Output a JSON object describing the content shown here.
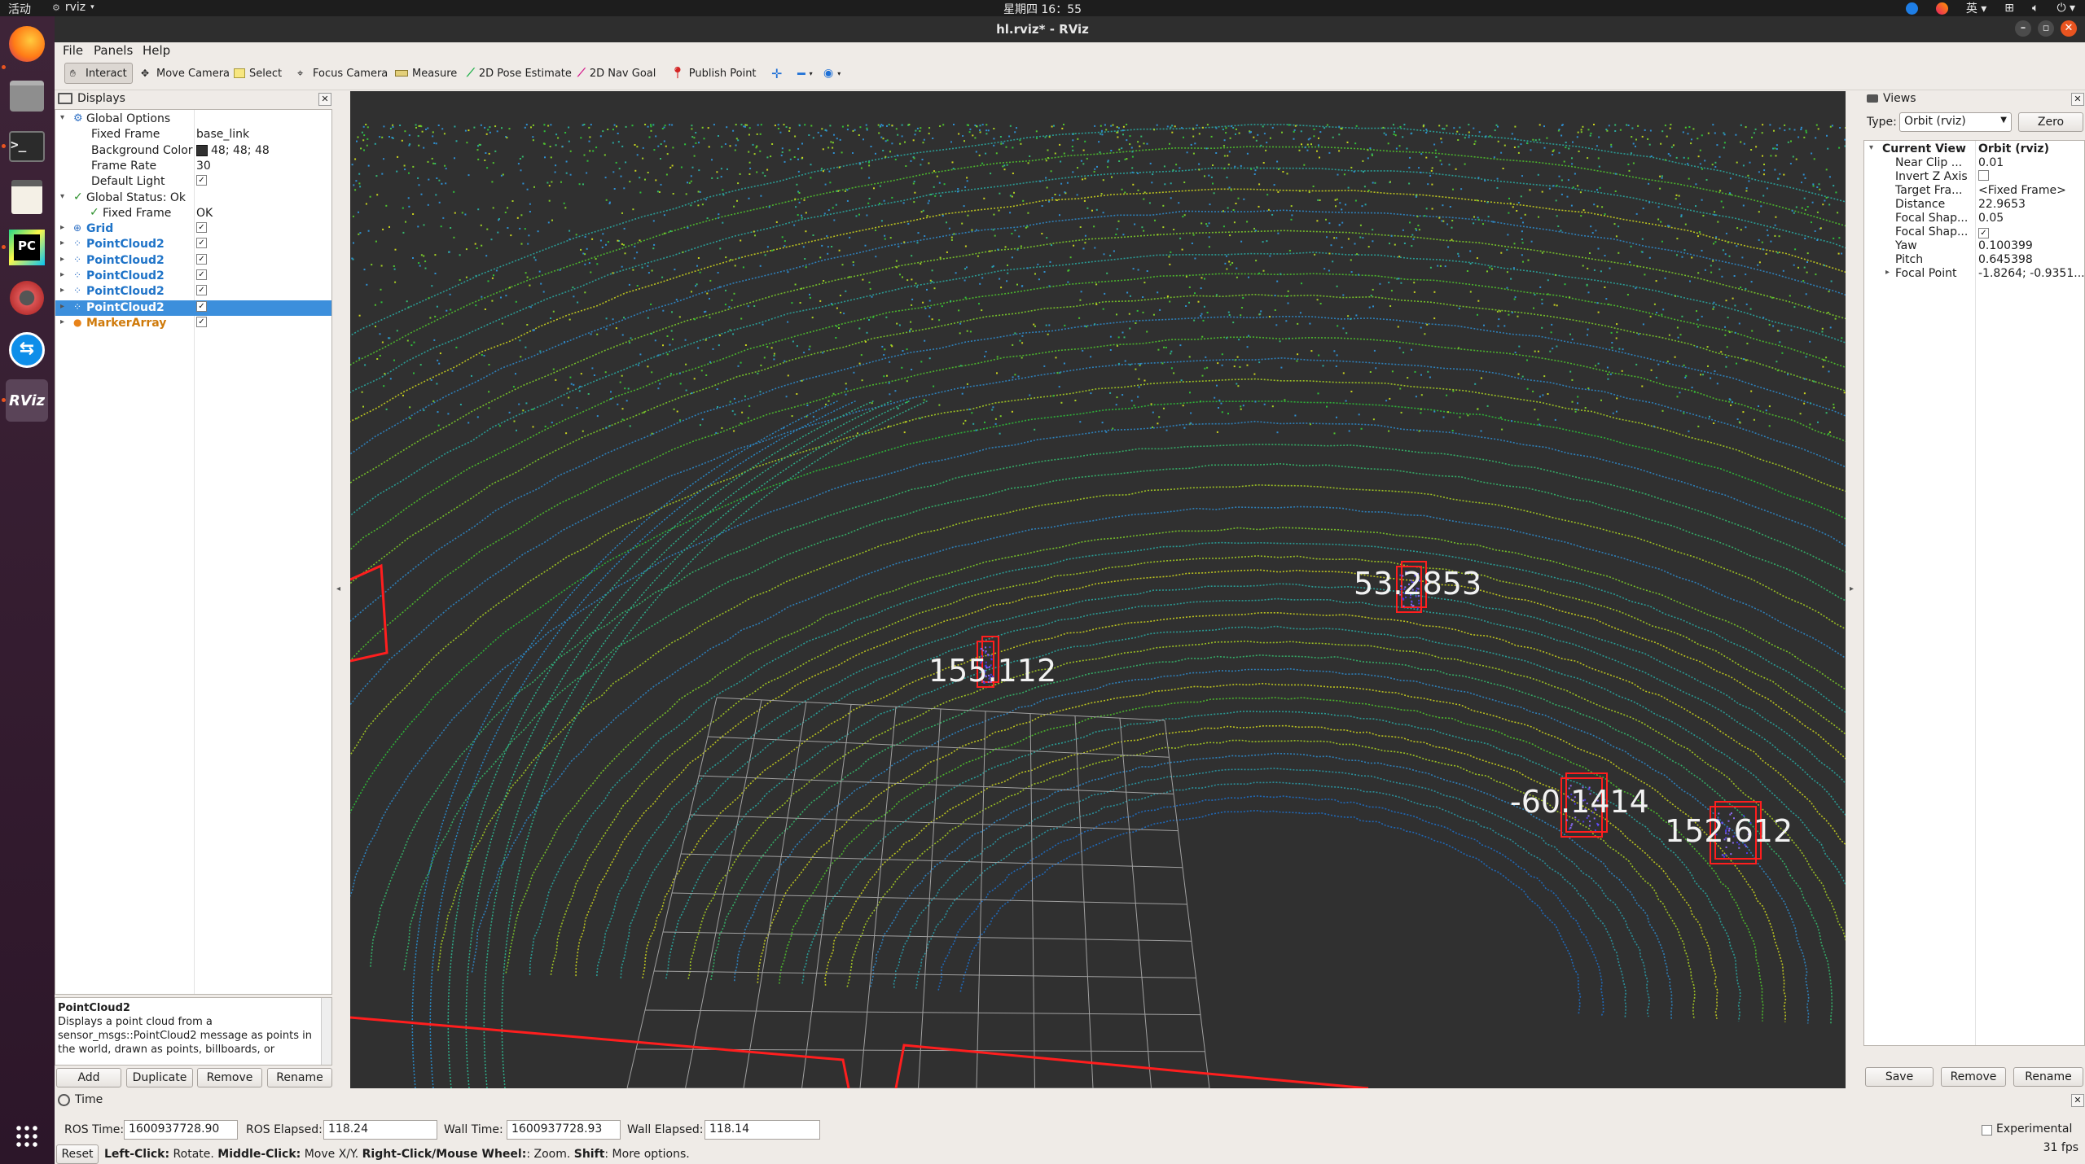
{
  "topbar": {
    "activities": "活动",
    "app_name": "rviz",
    "clock": "星期四 16：55",
    "input_method": "英"
  },
  "window": {
    "title": "hl.rviz* - RViz"
  },
  "dock": {
    "icons": [
      "firefox-icon",
      "files-icon",
      "terminal-icon",
      "text-editor-icon",
      "pycharm-icon",
      "settings-icon",
      "teamviewer-icon",
      "rviz-icon",
      "apps-grid-icon"
    ],
    "pycharm_text": "PC",
    "rviz_text": "RViz"
  },
  "menu": {
    "file": "File",
    "panels": "Panels",
    "help": "Help"
  },
  "toolbar": {
    "interact": "Interact",
    "move_camera": "Move Camera",
    "select": "Select",
    "focus_camera": "Focus Camera",
    "measure": "Measure",
    "pose_estimate": "2D Pose Estimate",
    "nav_goal": "2D Nav Goal",
    "publish_point": "Publish Point"
  },
  "displays": {
    "title": "Displays",
    "global_options": "Global Options",
    "fixed_frame_label": "Fixed Frame",
    "fixed_frame_value": "base_link",
    "bg_color_label": "Background Color",
    "bg_color_value": "48; 48; 48",
    "bg_color_swatch": "#303030",
    "frame_rate_label": "Frame Rate",
    "frame_rate_value": "30",
    "default_light_label": "Default Light",
    "global_status": "Global Status: Ok",
    "status_fixed_frame_label": "Fixed Frame",
    "status_fixed_frame_value": "OK",
    "items": [
      {
        "label": "Grid",
        "checked": true
      },
      {
        "label": "PointCloud2",
        "checked": true
      },
      {
        "label": "PointCloud2",
        "checked": true
      },
      {
        "label": "PointCloud2",
        "checked": true
      },
      {
        "label": "PointCloud2",
        "checked": true
      },
      {
        "label": "PointCloud2",
        "checked": true,
        "selected": true
      },
      {
        "label": "MarkerArray",
        "checked": true
      }
    ],
    "desc_title": "PointCloud2",
    "desc_text": "Displays a point cloud from a sensor_msgs::PointCloud2 message as points in the world, drawn as points, billboards, or",
    "buttons": {
      "add": "Add",
      "duplicate": "Duplicate",
      "remove": "Remove",
      "rename": "Rename"
    }
  },
  "viewport": {
    "markers": [
      "53.2853",
      "155.112",
      "-60.1414",
      "152.612"
    ],
    "colors": {
      "background": "#303030",
      "box": "#ff1e1e",
      "grid": "#a0a0a0"
    }
  },
  "views": {
    "title": "Views",
    "type_label": "Type:",
    "type_value": "Orbit (rviz)",
    "zero": "Zero",
    "current_view_label": "Current View",
    "current_view_value": "Orbit (rviz)",
    "props": [
      {
        "label": "Near Clip ...",
        "value": "0.01"
      },
      {
        "label": "Invert Z Axis",
        "value": "",
        "checkbox": true,
        "checked": false
      },
      {
        "label": "Target Fra...",
        "value": "<Fixed Frame>"
      },
      {
        "label": "Distance",
        "value": "22.9653"
      },
      {
        "label": "Focal Shap...",
        "value": "0.05"
      },
      {
        "label": "Focal Shap...",
        "value": "",
        "checkbox": true,
        "checked": true
      },
      {
        "label": "Yaw",
        "value": "0.100399"
      },
      {
        "label": "Pitch",
        "value": "0.645398"
      },
      {
        "label": "Focal Point",
        "value": "-1.8264; -0.9351..."
      }
    ],
    "buttons": {
      "save": "Save",
      "remove": "Remove",
      "rename": "Rename"
    }
  },
  "time": {
    "title": "Time",
    "ros_time_label": "ROS Time:",
    "ros_time_value": "1600937728.90",
    "ros_elapsed_label": "ROS Elapsed:",
    "ros_elapsed_value": "118.24",
    "wall_time_label": "Wall Time:",
    "wall_time_value": "1600937728.93",
    "wall_elapsed_label": "Wall Elapsed:",
    "wall_elapsed_value": "118.14",
    "experimental": "Experimental",
    "fps": "31 fps"
  },
  "status": {
    "reset": "Reset",
    "left_click": "Left-Click:",
    "left_click_text": " Rotate. ",
    "middle_click": "Middle-Click:",
    "middle_click_text": " Move X/Y. ",
    "right_click": "Right-Click/Mouse Wheel:",
    "right_click_text": ": Zoom. ",
    "shift": "Shift",
    "shift_text": ": More options."
  }
}
